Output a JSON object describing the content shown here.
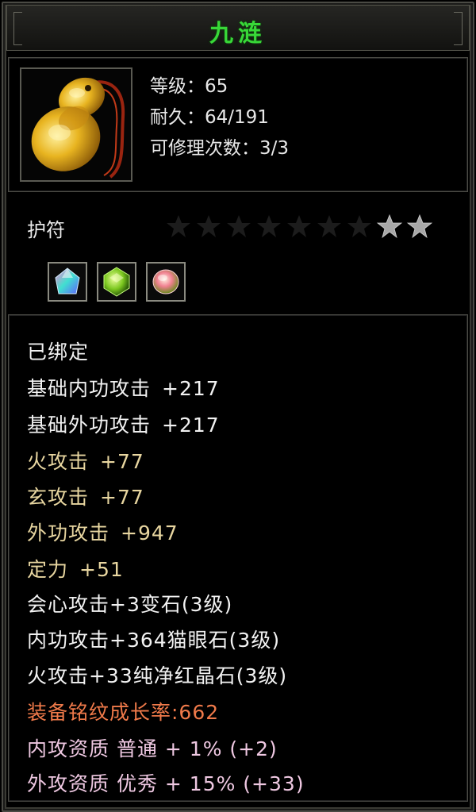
{
  "title": "九涟",
  "item": {
    "icon": "jade-gourd-amulet-icon",
    "level_label": "等级：",
    "level": "65",
    "durability_label": "耐久：",
    "durability": "64/191",
    "repair_label": "可修理次数：",
    "repair": "3/3",
    "type": "护符",
    "stars_total": 9,
    "stars_lit": 2
  },
  "gems": [
    "prism-gem-icon",
    "green-gem-icon",
    "pink-gem-icon"
  ],
  "attrs": {
    "bound": "已绑定",
    "base_inner_label": "基础内功攻击",
    "base_inner_value": "+217",
    "base_outer_label": "基础外功攻击",
    "base_outer_value": "+217",
    "fire_label": "火攻击",
    "fire_value": "+77",
    "xuan_label": "玄攻击",
    "xuan_value": "+77",
    "outer_label": "外功攻击",
    "outer_value": "+947",
    "focus_label": "定力",
    "focus_value": "+51",
    "gem1": "会心攻击+3变石(3级)",
    "gem2": "内功攻击+364猫眼石(3级)",
    "gem3": "火攻击+33纯净红晶石(3级)",
    "growth": "装备铭纹成长率:662",
    "inner_quality": "内攻资质 普通 + 1% (+2)",
    "outer_quality": "外攻资质 优秀 + 15% (+33)"
  },
  "colors": {
    "title": "#38d838",
    "normal": "#f2f2f2",
    "tan": "#e8d6a0",
    "growth": "#f07a4a",
    "quality": "#efc8e2",
    "star_lit": "#a8a8a8",
    "star_dim": "#1c1c1c"
  }
}
